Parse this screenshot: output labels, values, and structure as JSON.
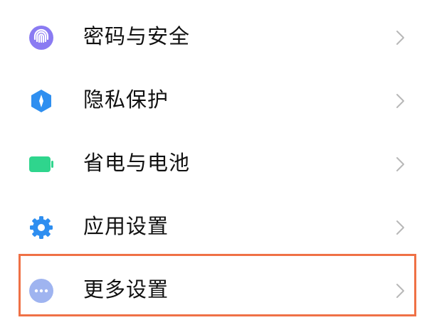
{
  "settings": {
    "items": [
      {
        "label": "密码与安全",
        "icon": "fingerprint-icon",
        "icon_color": "#8a7bf2"
      },
      {
        "label": "隐私保护",
        "icon": "privacy-shield-icon",
        "icon_color": "#2f8ff0"
      },
      {
        "label": "省电与电池",
        "icon": "battery-icon",
        "icon_color": "#2fd58d"
      },
      {
        "label": "应用设置",
        "icon": "gear-icon",
        "icon_color": "#2e8ef0"
      },
      {
        "label": "更多设置",
        "icon": "more-dots-icon",
        "icon_color": "#9fb4f0"
      }
    ],
    "chevron_icon": "chevron-right-icon",
    "highlight_color": "#ef7146"
  }
}
